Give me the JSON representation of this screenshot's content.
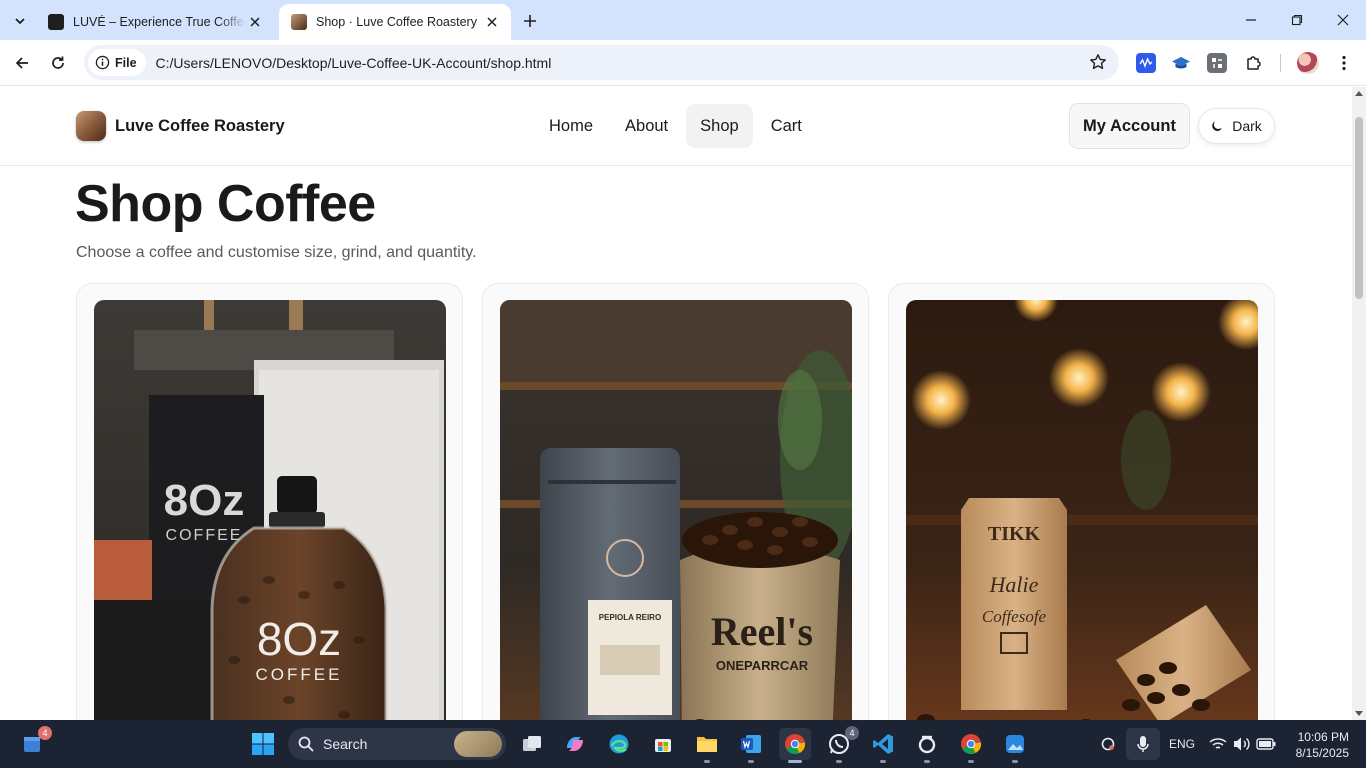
{
  "browser": {
    "tabs": [
      {
        "title": "LUVÉ – Experience True Coffee Q",
        "active": false,
        "favicon": "luve-icon"
      },
      {
        "title": "Shop · Luve Coffee Roastery",
        "active": true,
        "favicon": "coffee-icon"
      }
    ],
    "site_chip_label": "File",
    "url": "C:/Users/LENOVO/Desktop/Luve-Coffee-UK-Account/shop.html"
  },
  "site": {
    "brand_name": "Luve Coffee Roastery",
    "nav": [
      {
        "label": "Home",
        "current": false
      },
      {
        "label": "About",
        "current": false
      },
      {
        "label": "Shop",
        "current": true
      },
      {
        "label": "Cart",
        "current": false
      }
    ],
    "account_label": "My Account",
    "theme_toggle_label": "Dark"
  },
  "main": {
    "title": "Shop Coffee",
    "subtitle": "Choose a coffee and customise size, grind, and quantity.",
    "products": [
      {
        "image": "80z coffee bottle of beans"
      },
      {
        "image": "grey coffee bag and burlap sack of beans"
      },
      {
        "image": "kraft paper coffee bag with spilled beans"
      }
    ],
    "product_image_texts": [
      {
        "brand": "8Oz",
        "sub": "COFFEE"
      },
      {
        "bag": "PEPIOLA REIRO",
        "sack": "Reel's",
        "sack_sub": "ONEPARRCAR"
      },
      {
        "bag": "TIKK",
        "bag_sub": "Halie",
        "bag_line": "Coffesofe"
      }
    ]
  },
  "taskbar": {
    "search_label": "Search",
    "badges": {
      "calendar": "4",
      "whatsapp": "4"
    },
    "language": "ENG",
    "time": "10:06 PM",
    "date": "8/15/2025"
  },
  "colors": {
    "tabstrip_bg": "#d3e3fd",
    "taskbar_bg": "#1c2333",
    "text_primary": "#1a1a1a",
    "text_muted": "#5a5a5a"
  }
}
